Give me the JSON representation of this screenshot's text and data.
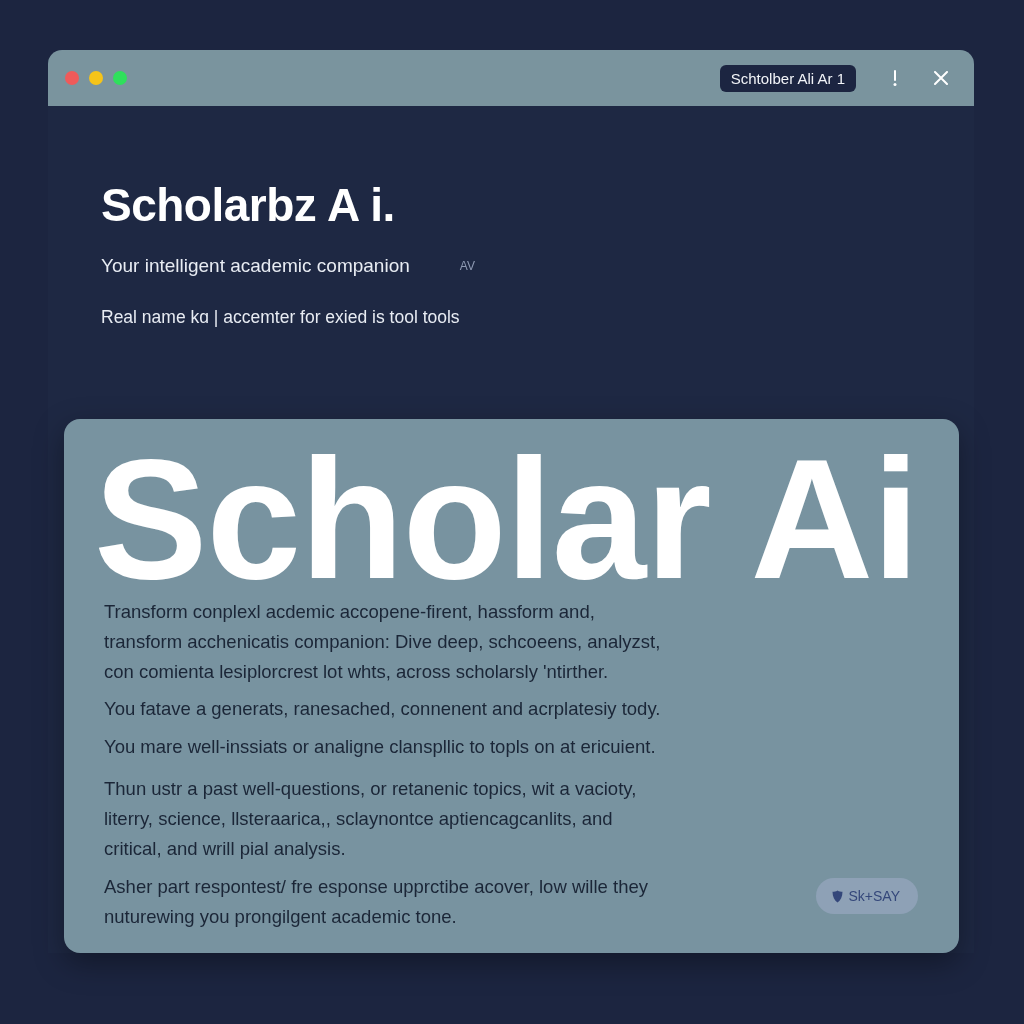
{
  "window": {
    "traffic_lights": [
      {
        "color": "#ef5a5a"
      },
      {
        "color": "#f5c419"
      },
      {
        "color": "#2fe05c"
      }
    ],
    "title_badge": "Schtolber Ali Ar 1"
  },
  "header": {
    "title": "Scholarbz A i.",
    "subtitle": "Your intelligent academic companion",
    "subtitle_tag": "AV",
    "tagline": "Real name kɑ | accemter for exied is tool tools"
  },
  "card": {
    "title": "Scholar Ai",
    "paragraphs": [
      {
        "lines": [
          "Transform conplexl acdemic accopene-firent, hassform and,",
          "transform acchenicatis companion: Dive deep, schcoeens, analyzst,",
          "con comienta lesiplorcrest lot whts, across scholarsly 'ntirther."
        ]
      },
      {
        "lines": [
          "You fatave a generats, ranesached, connenent and acrplatesiy tody."
        ]
      },
      {
        "lines": [
          "You mare well-inssiats or analigne clanspllic to topls on at ericuient."
        ]
      },
      {
        "lines": [
          "Thun ustr a past well-questions, or retanenic topics, wit a vacioty,",
          "literry, science, llsteraarica,, sclaynontce aptiencagcanlits, and",
          "critical, and wrill pial analysis."
        ]
      },
      {
        "lines": [
          "Asher part respontest/ fre esponse upprctibe acover, low wille they",
          "nuturewing you prongilgent academic tone."
        ]
      }
    ],
    "button": {
      "label": "Sk+SAY"
    }
  }
}
